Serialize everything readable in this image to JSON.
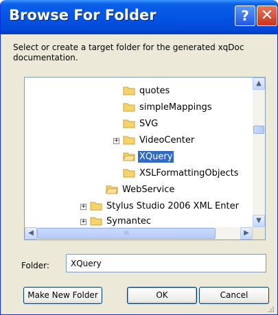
{
  "window": {
    "title": "Browse For Folder",
    "help_icon": "?",
    "close_icon": "✕"
  },
  "description": "Select or create a target folder for the generated xqDoc documentation.",
  "tree": {
    "items": [
      {
        "label": "quotes",
        "icon": "folder-icon",
        "expander": null,
        "selected": false
      },
      {
        "label": "simpleMappings",
        "icon": "folder-icon",
        "expander": null,
        "selected": false
      },
      {
        "label": "SVG",
        "icon": "folder-icon",
        "expander": null,
        "selected": false
      },
      {
        "label": "VideoCenter",
        "icon": "folder-icon",
        "expander": "+",
        "selected": false
      },
      {
        "label": "XQuery",
        "icon": "folder-open-icon",
        "expander": null,
        "selected": true
      },
      {
        "label": "XSLFormattingObjects",
        "icon": "folder-icon",
        "expander": null,
        "selected": false
      },
      {
        "label": "WebService",
        "icon": "folder-open-icon",
        "expander": null,
        "selected": false
      },
      {
        "label": "Stylus Studio 2006 XML Enter",
        "icon": "folder-icon",
        "expander": "+",
        "selected": false
      },
      {
        "label": "Symantec",
        "icon": "folder-icon",
        "expander": "+",
        "selected": false
      }
    ],
    "scroll_up": "▲",
    "scroll_down": "▼",
    "scroll_left": "◀",
    "scroll_right": "▶",
    "hthumb_grip": "III"
  },
  "folder_field": {
    "label": "Folder:",
    "value": "XQuery"
  },
  "buttons": {
    "make_new_folder": "Make New Folder",
    "ok": "OK",
    "cancel": "Cancel"
  },
  "colors": {
    "titlebar": "#0554E3",
    "selection": "#316AC5",
    "dialog_bg": "#ECE9D8"
  }
}
